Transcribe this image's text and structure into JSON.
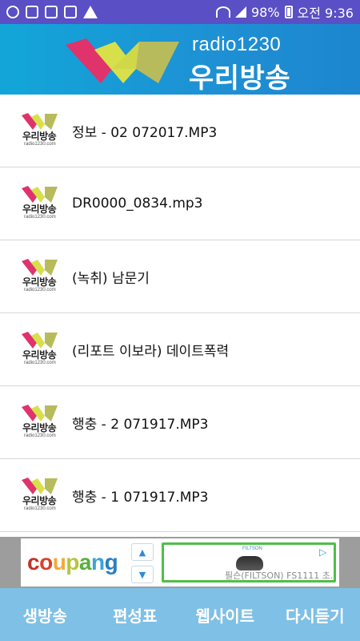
{
  "status_bar": {
    "left_icons": [
      "upload-icon",
      "image-icon",
      "mail-icon",
      "message-icon",
      "warning-icon"
    ],
    "battery_percent": "98%",
    "time": "오전 9:36"
  },
  "header": {
    "brand_top": "radio1230",
    "brand_main": "우리방송",
    "colors": {
      "magenta": "#e0336b",
      "yellow": "#d7e04a",
      "olive": "#b8bb5c",
      "bg": "#1a9ad6"
    }
  },
  "list": {
    "thumb_label": "우리방송",
    "thumb_url": "radio1230.com",
    "items": [
      {
        "title": "정보 - 02 072017.MP3"
      },
      {
        "title": "DR0000_0834.mp3"
      },
      {
        "title": "(녹취) 남문기"
      },
      {
        "title": "(리포트 이보라) 데이트폭력"
      },
      {
        "title": "행충 - 2 071917.MP3"
      },
      {
        "title": "행충 - 1 071917.MP3"
      }
    ]
  },
  "ad": {
    "brand": [
      "c",
      "o",
      "u",
      "p",
      "a",
      "n",
      "g"
    ],
    "brand_colors": [
      "#c0342a",
      "#d8422a",
      "#f0a93a",
      "#b5c63b",
      "#5aae3e",
      "#3aa3d9",
      "#2c7fc1"
    ],
    "product_logo": "FILTSON",
    "product_text": "필슨(FILTSON) FS1111 초..."
  },
  "bottom_nav": {
    "items": [
      "생방송",
      "편성표",
      "웹사이트",
      "다시듣기"
    ]
  }
}
